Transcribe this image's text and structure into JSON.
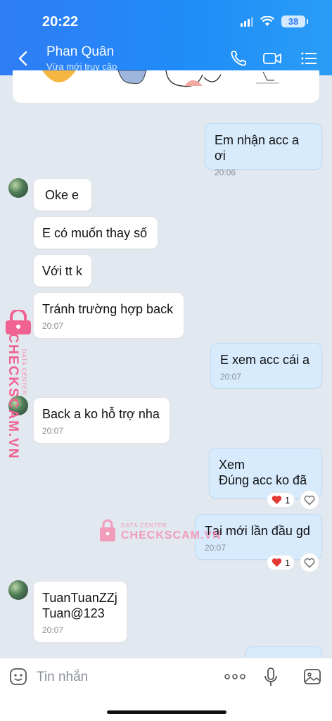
{
  "status_bar": {
    "time": "20:22",
    "battery": "38"
  },
  "header": {
    "contact_name": "Phan Quân",
    "contact_status": "Vừa mới truy cập"
  },
  "messages": [
    {
      "dir": "out",
      "text": "Em nhận acc a ơi",
      "time": "20:06"
    },
    {
      "dir": "in",
      "text": "Oke e"
    },
    {
      "dir": "in",
      "text": "E có muốn thay số"
    },
    {
      "dir": "in",
      "text": "Với tt k"
    },
    {
      "dir": "in",
      "text": "Tránh trường hợp back",
      "time": "20:07"
    },
    {
      "dir": "out",
      "text": "E xem acc cái a",
      "time": "20:07"
    },
    {
      "dir": "in",
      "text": "Back a ko hỗ trợ nha",
      "time": "20:07"
    },
    {
      "dir": "out",
      "text": "Xem\nĐúng acc ko đã",
      "reaction_count": "1"
    },
    {
      "dir": "out",
      "text": "Tại mới lần đầu gd",
      "time": "20:07",
      "reaction_count": "1"
    },
    {
      "dir": "in",
      "text": "TuanTuanZZj\nTuan@123",
      "time": "20:07"
    }
  ],
  "watermark": {
    "small": "DATA CENTER",
    "brand": "CHECKSCAM.VN"
  },
  "input": {
    "placeholder": "Tin nhắn"
  },
  "colors": {
    "header": "#2f7cf6",
    "out_bubble": "#d7ebfd",
    "in_bubble": "#ffffff",
    "background": "#e2e8ef",
    "watermark": "#f06292"
  },
  "icons": [
    "back-icon",
    "phone-icon",
    "video-call-icon",
    "menu-icon",
    "sticker-icon",
    "more-icon",
    "microphone-icon",
    "image-icon",
    "heart-icon",
    "like-icon"
  ]
}
